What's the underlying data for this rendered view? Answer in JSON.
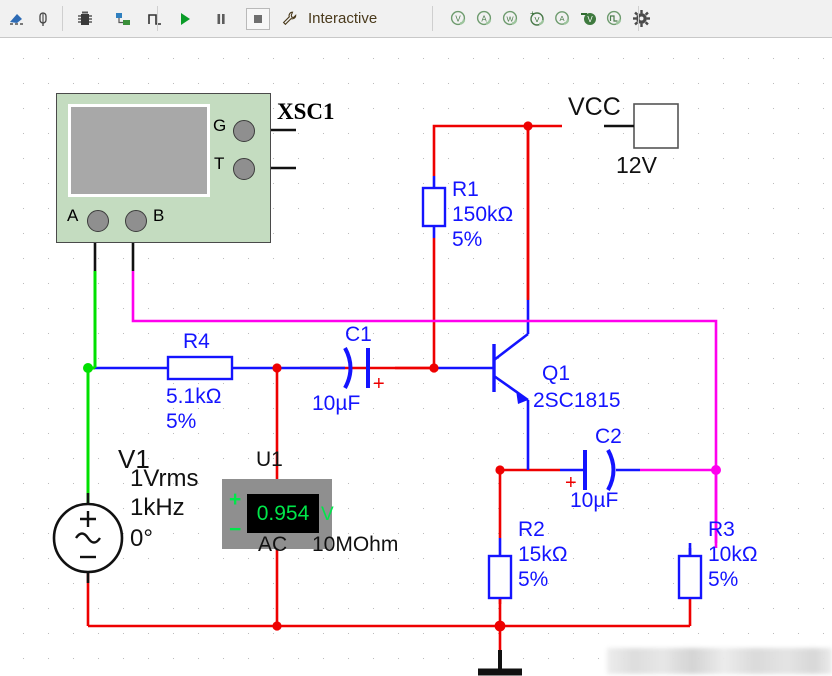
{
  "toolbar": {
    "left_icons": [
      {
        "name": "place-component-icon",
        "glyph": "⚑"
      },
      {
        "name": "probe-icon",
        "glyph": "⌇"
      },
      {
        "name": "ic-chip-icon",
        "glyph": "▦"
      },
      {
        "name": "hierarchy-block-icon",
        "glyph": "⧉"
      },
      {
        "name": "digital-step-icon",
        "glyph": "⎋"
      }
    ],
    "run_label": "run-simulation",
    "pause_label": "pause-simulation",
    "stop_label": "stop-simulation",
    "mode_icon": "wrench-icon",
    "mode_text": "Interactive",
    "probe_icons": [
      {
        "name": "voltage-probe-icon",
        "letter": "V"
      },
      {
        "name": "current-probe-icon",
        "letter": "A"
      },
      {
        "name": "power-probe-icon",
        "letter": "W"
      },
      {
        "name": "differential-voltage-probe-icon",
        "letter": "V"
      },
      {
        "name": "differential-current-probe-icon",
        "letter": "A"
      },
      {
        "name": "reference-voltage-probe-icon",
        "letter": "V"
      },
      {
        "name": "digital-probe-icon",
        "letter": "⎋"
      },
      {
        "name": "probe-settings-icon",
        "letter": "⚙"
      }
    ]
  },
  "instruments": {
    "oscilloscope": {
      "ref": "XSC1",
      "terminals": [
        {
          "name": "channel-a-terminal",
          "label": "A"
        },
        {
          "name": "channel-b-terminal",
          "label": "B"
        },
        {
          "name": "ground-terminal",
          "label": "G"
        },
        {
          "name": "trigger-terminal",
          "label": "T"
        }
      ]
    },
    "multimeter": {
      "ref": "U1",
      "value": "0.954",
      "unit": "V",
      "plus": "+",
      "minus": "−",
      "mode": "AC",
      "impedance": "10MOhm"
    }
  },
  "components": {
    "vcc": {
      "name": "VCC",
      "value": "12V"
    },
    "v1": {
      "ref": "V1",
      "amplitude": "1Vrms",
      "frequency": "1kHz",
      "phase": "0°"
    },
    "q1": {
      "ref": "Q1",
      "part": "2SC1815"
    },
    "r1": {
      "ref": "R1",
      "value": "150kΩ",
      "tolerance": "5%"
    },
    "r2": {
      "ref": "R2",
      "value": "15kΩ",
      "tolerance": "5%"
    },
    "r3": {
      "ref": "R3",
      "value": "10kΩ",
      "tolerance": "5%"
    },
    "r4": {
      "ref": "R4",
      "value": "5.1kΩ",
      "tolerance": "5%"
    },
    "c1": {
      "ref": "C1",
      "value": "10µF",
      "polarity": "+"
    },
    "c2": {
      "ref": "C2",
      "value": "10µF",
      "polarity": "+"
    }
  },
  "colors": {
    "wire_red": "#ee0000",
    "wire_blue": "#1414ff",
    "wire_green": "#00e000",
    "wire_magenta": "#ff00ee",
    "component_blue": "#1414ff",
    "scope_body": "#c4dcc0",
    "display_green": "#00e64a",
    "toolbar_bg": "#f1f1f1"
  }
}
